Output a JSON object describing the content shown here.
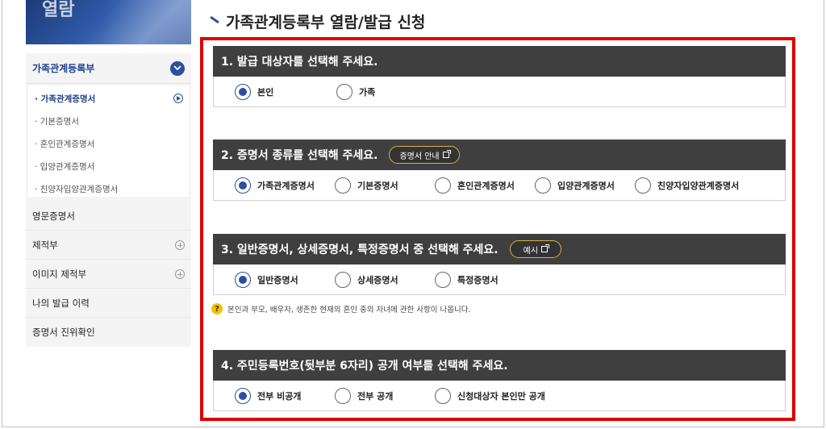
{
  "hero": {
    "text": "열람"
  },
  "sidebar": {
    "header": "가족관계등록부",
    "sub_items": [
      {
        "label": "· 가족관계증명서",
        "active": true
      },
      {
        "label": "· 기본증명서"
      },
      {
        "label": "· 혼인관계증명서"
      },
      {
        "label": "· 입양관계증명서"
      },
      {
        "label": "· 친양자입양관계증명서"
      }
    ],
    "items": [
      {
        "label": "영문증명서",
        "expandable": false
      },
      {
        "label": "제적부",
        "expandable": true
      },
      {
        "label": "이미지 제적부",
        "expandable": true
      },
      {
        "label": "나의 발급 이력",
        "expandable": false
      },
      {
        "label": "증명서 진위확인",
        "expandable": false
      }
    ]
  },
  "page": {
    "title": "가족관계등록부 열람/발급 신청"
  },
  "sections": [
    {
      "title": "1. 발급 대상자를 선택해 주세요.",
      "options": [
        "본인",
        "가족"
      ],
      "selected": 0
    },
    {
      "title": "2. 증명서 종류를 선택해 주세요.",
      "button": "증명서 안내",
      "options": [
        "가족관계증명서",
        "기본증명서",
        "혼인관계증명서",
        "입양관계증명서",
        "친양자입양관계증명서"
      ],
      "selected": 0
    },
    {
      "title": "3. 일반증명서, 상세증명서, 특정증명서 중 선택해 주세요.",
      "button": "예시",
      "options": [
        "일반증명서",
        "상세증명서",
        "특정증명서"
      ],
      "selected": 0
    },
    {
      "title": "4. 주민등록번호(뒷부분 6자리) 공개 여부를 선택해 주세요.",
      "options": [
        "전부 비공개",
        "전부 공개",
        "신청대상자 본인만 공개"
      ],
      "selected": 0
    }
  ],
  "note": {
    "text": "본인과 부모, 배우자, 생존한 현재의 혼인 중의 자녀에 관한 사항이 나옵니다."
  },
  "colors": {
    "accent": "#2b4f9d",
    "header_bg": "#3f3f3f",
    "highlight_border": "#e00000",
    "pill_border": "#d9b04a"
  }
}
